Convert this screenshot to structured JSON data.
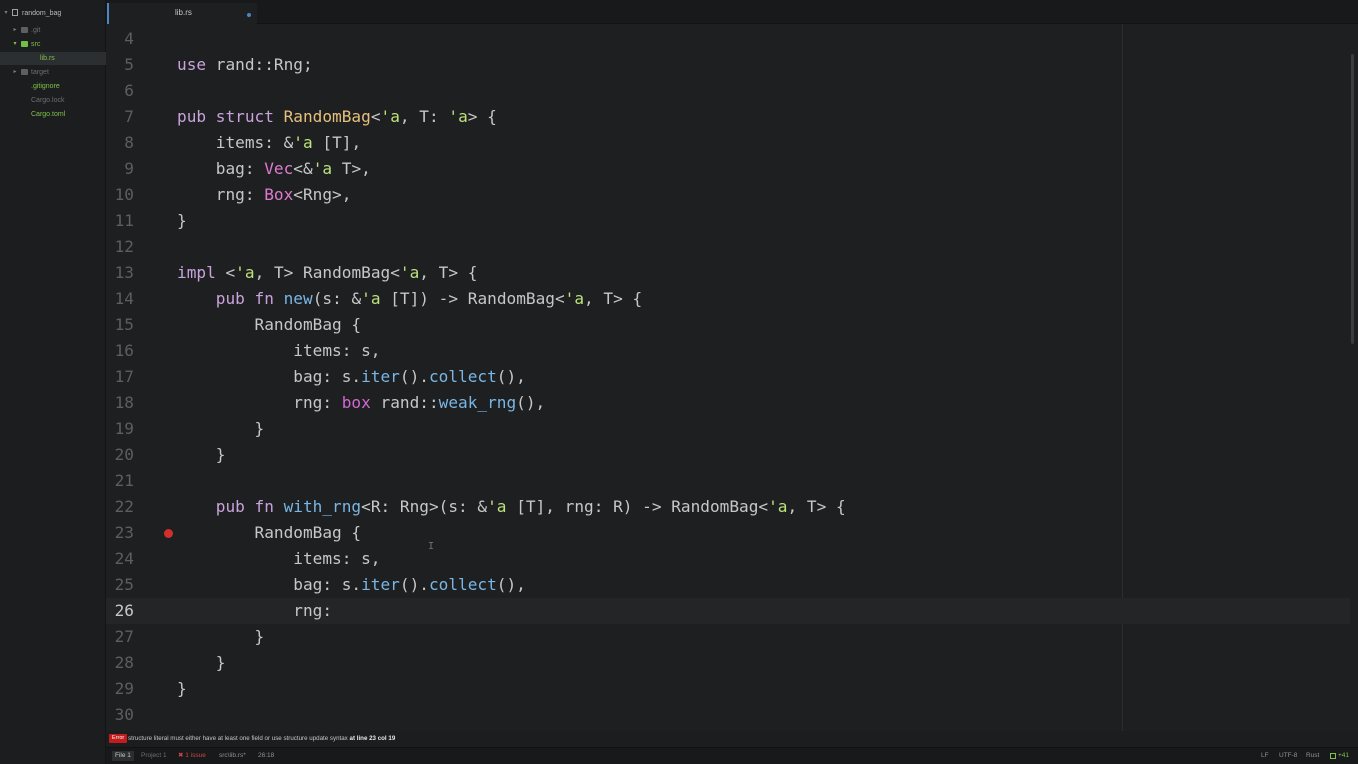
{
  "tree": {
    "project": "random_bag",
    "items": [
      {
        "label": ".git",
        "kind": "folder"
      },
      {
        "label": "src",
        "kind": "folder-open"
      },
      {
        "label": "lib.rs",
        "kind": "file"
      },
      {
        "label": "target",
        "kind": "folder"
      },
      {
        "label": ".gitignore",
        "kind": "file"
      },
      {
        "label": "Cargo.lock",
        "kind": "file"
      },
      {
        "label": "Cargo.toml",
        "kind": "file"
      }
    ]
  },
  "tab": {
    "title": "lib.rs"
  },
  "editor": {
    "cursor_line": 26,
    "breakpoint_line": 23,
    "lines": [
      {
        "n": "4",
        "t": []
      },
      {
        "n": "5",
        "t": [
          [
            "kw",
            "use"
          ],
          [
            "",
            "rand::Rng;"
          ]
        ]
      },
      {
        "n": "6",
        "t": []
      },
      {
        "n": "7",
        "t": [
          [
            "kw",
            "pub struct"
          ],
          [
            "",
            ""
          ],
          [
            "ty",
            "RandomBag"
          ],
          [
            "",
            "<"
          ],
          [
            "lt",
            "'a"
          ],
          [
            "",
            ", T: "
          ],
          [
            "lt",
            "'a"
          ],
          [
            "",
            "> {"
          ]
        ]
      },
      {
        "n": "8",
        "t": [
          [
            "",
            "    items: &"
          ],
          [
            "lt",
            "'a"
          ],
          [
            "",
            ""
          ],
          [
            "",
            "[T],"
          ]
        ]
      },
      {
        "n": "9",
        "t": [
          [
            "",
            "    bag: "
          ],
          [
            "tyg",
            "Vec"
          ],
          [
            "",
            "<&"
          ],
          [
            "lt",
            "'a"
          ],
          [
            "",
            "T>,"
          ]
        ]
      },
      {
        "n": "10",
        "t": [
          [
            "",
            "    rng: "
          ],
          [
            "tyg",
            "Box"
          ],
          [
            "",
            "<Rng>,"
          ]
        ]
      },
      {
        "n": "11",
        "t": [
          [
            "",
            "}"
          ]
        ]
      },
      {
        "n": "12",
        "t": []
      },
      {
        "n": "13",
        "t": [
          [
            "kw",
            "impl"
          ],
          [
            "",
            "<"
          ],
          [
            "lt",
            "'a"
          ],
          [
            "",
            ", T> RandomBag<"
          ],
          [
            "lt",
            "'a"
          ],
          [
            "",
            ", T> {"
          ]
        ]
      },
      {
        "n": "14",
        "t": [
          [
            "",
            "    "
          ],
          [
            "kw",
            "pub fn"
          ],
          [
            "",
            ""
          ],
          [
            "fn",
            "new"
          ],
          [
            "",
            "(s: &"
          ],
          [
            "lt",
            "'a"
          ],
          [
            "",
            "[T]) -> RandomBag<"
          ],
          [
            "lt",
            "'a"
          ],
          [
            "",
            ", T> {"
          ]
        ]
      },
      {
        "n": "15",
        "t": [
          [
            "",
            "        RandomBag {"
          ]
        ]
      },
      {
        "n": "16",
        "t": [
          [
            "",
            "            items: s,"
          ]
        ]
      },
      {
        "n": "17",
        "t": [
          [
            "",
            "            bag: s."
          ],
          [
            "fn",
            "iter"
          ],
          [
            "",
            "()."
          ],
          [
            "fn",
            "collect"
          ],
          [
            "",
            "(),"
          ]
        ]
      },
      {
        "n": "18",
        "t": [
          [
            "",
            "            rng: "
          ],
          [
            "mac",
            "box"
          ],
          [
            "",
            "rand::"
          ],
          [
            "fn",
            "weak_rng"
          ],
          [
            "",
            "(),"
          ]
        ]
      },
      {
        "n": "19",
        "t": [
          [
            "",
            "        }"
          ]
        ]
      },
      {
        "n": "20",
        "t": [
          [
            "",
            "    }"
          ]
        ]
      },
      {
        "n": "21",
        "t": []
      },
      {
        "n": "22",
        "t": [
          [
            "",
            "    "
          ],
          [
            "kw",
            "pub fn"
          ],
          [
            "",
            ""
          ],
          [
            "fn",
            "with_rng"
          ],
          [
            "",
            "<R: Rng>(s: &"
          ],
          [
            "lt",
            "'a"
          ],
          [
            "",
            "[T], rng: R) -> RandomBag<"
          ],
          [
            "lt",
            "'a"
          ],
          [
            "",
            ", T> {"
          ]
        ]
      },
      {
        "n": "23",
        "t": [
          [
            "",
            "        RandomBag {"
          ]
        ]
      },
      {
        "n": "24",
        "t": [
          [
            "",
            "            items: s,"
          ]
        ]
      },
      {
        "n": "25",
        "t": [
          [
            "",
            "            bag: s."
          ],
          [
            "fn",
            "iter"
          ],
          [
            "",
            "()."
          ],
          [
            "fn",
            "collect"
          ],
          [
            "",
            "(),"
          ]
        ]
      },
      {
        "n": "26",
        "t": [
          [
            "",
            "            rng:"
          ]
        ]
      },
      {
        "n": "27",
        "t": [
          [
            "",
            "        }"
          ]
        ]
      },
      {
        "n": "28",
        "t": [
          [
            "",
            "    }"
          ]
        ]
      },
      {
        "n": "29",
        "t": [
          [
            "",
            "}"
          ]
        ]
      },
      {
        "n": "30",
        "t": []
      }
    ]
  },
  "linter": {
    "badge": "Error",
    "message": "structure literal must either have at least one field or use structure update syntax",
    "location": "at line 23 col 19"
  },
  "status": {
    "file": "File 1",
    "project": "Project 1",
    "issues": "✖ 1 issue",
    "path": "src\\lib.rs*",
    "position": "26:18",
    "line_ending": "LF",
    "encoding": "UTF-8",
    "grammar": "Rust",
    "git": "+41"
  },
  "colors": {
    "background": "#1d1f21",
    "accent": "#4b86c2",
    "error": "#c21c1c",
    "git_added": "#7fc248"
  }
}
